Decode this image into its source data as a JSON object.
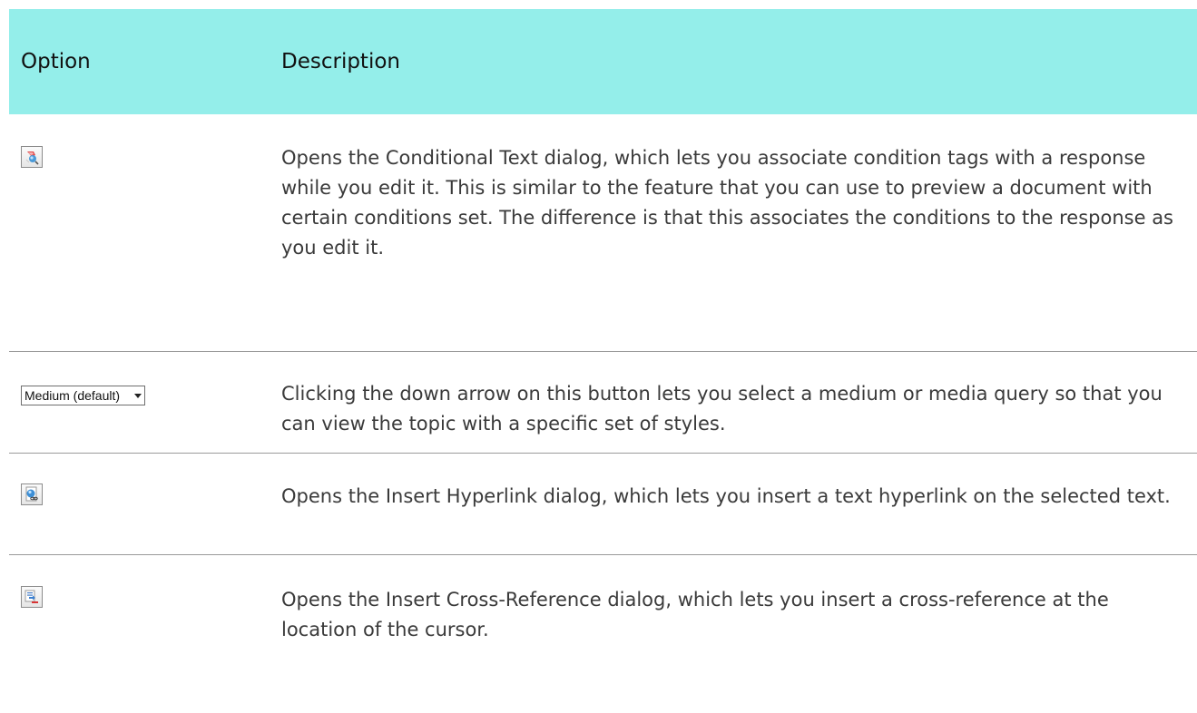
{
  "table": {
    "headers": {
      "option": "Option",
      "description": "Description"
    },
    "rows": [
      {
        "option_icon": "conditional-text-icon",
        "description": "Opens the Conditional Text dialog, which lets you associate condition tags with a response while you edit it. This is similar to the feature that you can use to preview a document with certain conditions set. The difference is that this associates the conditions to the response as you edit it."
      },
      {
        "option_label": "Medium (default)",
        "option_icon": "chevron-down-icon",
        "description": "Clicking the down arrow on this button lets you select a medium or media query so that you can view the topic with a specific set of styles."
      },
      {
        "option_icon": "insert-hyperlink-icon",
        "description": "Opens the Insert Hyperlink dialog, which lets you insert a text hyperlink on the selected text."
      },
      {
        "option_icon": "insert-cross-reference-icon",
        "description": "Opens the Insert Cross-Reference dialog, which lets you insert a cross-reference at the location of the cursor."
      }
    ]
  },
  "colors": {
    "header_background": "#94eeea",
    "row_divider": "#9a9a9a",
    "body_text": "#3a3a3a"
  }
}
